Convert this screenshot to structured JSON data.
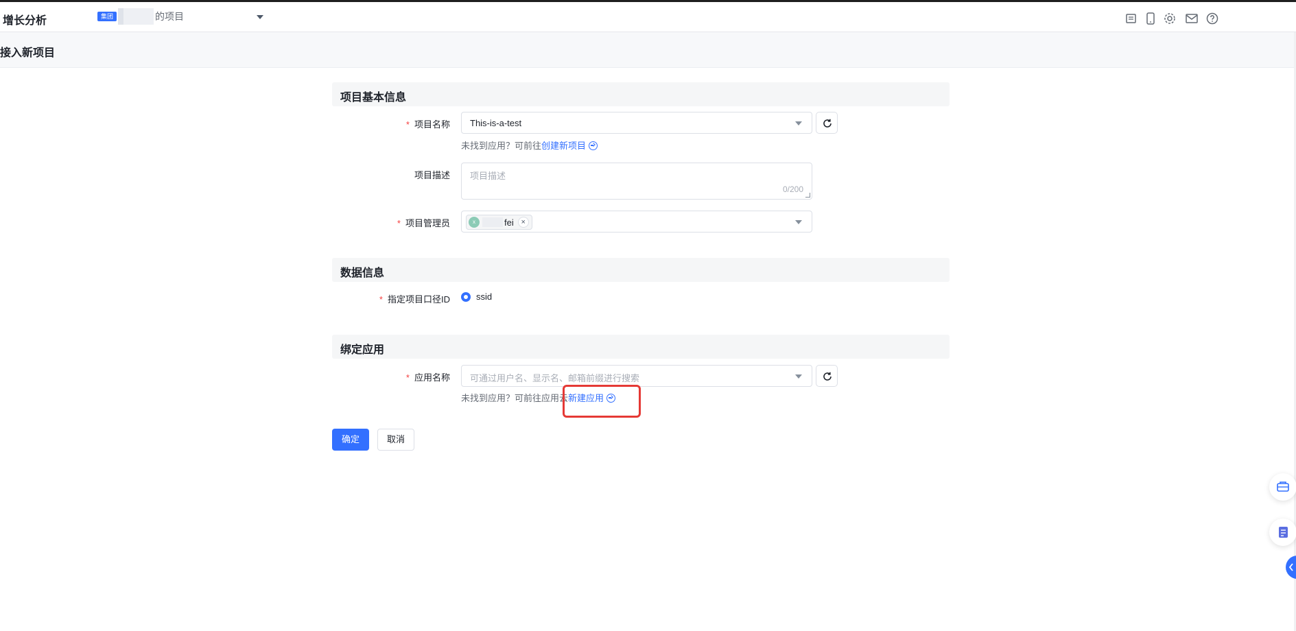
{
  "topbar": {
    "brand": "增长分析",
    "org_tag": "集团",
    "org_suffix": "的项目",
    "icons": [
      "report-icon",
      "mobile-icon",
      "gear-icon",
      "mail-icon",
      "help-icon"
    ]
  },
  "page": {
    "title": "接入新项目"
  },
  "sections": {
    "basic": "项目基本信息",
    "data": "数据信息",
    "bind": "绑定应用"
  },
  "fields": {
    "project_name": {
      "label": "项目名称",
      "value": "This-is-a-test"
    },
    "project_hint": {
      "text": "未找到应用？可前往",
      "link": "创建新项目"
    },
    "description": {
      "label": "项目描述",
      "placeholder": "项目描述",
      "count": "0/200"
    },
    "admin": {
      "label": "项目管理员",
      "avatar": "x",
      "tag_text": "fei",
      "close": "×"
    },
    "id_type": {
      "label": "指定项目口径ID",
      "option": "ssid"
    },
    "app_name": {
      "label": "应用名称",
      "placeholder": "可通过用户名、显示名、邮箱前缀进行搜索"
    },
    "app_hint": {
      "text": "未找到应用？可前往应用云",
      "link": "新建应用"
    }
  },
  "buttons": {
    "confirm": "确定",
    "cancel": "取消"
  },
  "required_mark": "*",
  "colors": {
    "primary": "#3370ff",
    "highlight": "#e53935",
    "required": "#f53f3f"
  }
}
